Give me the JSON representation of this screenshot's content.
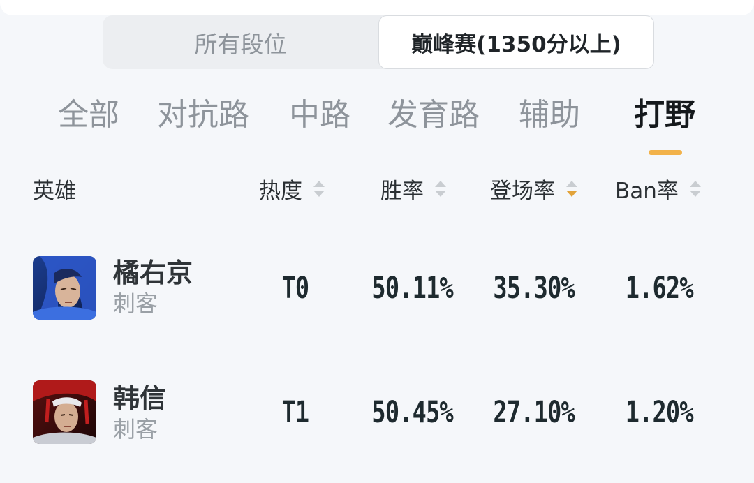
{
  "rank_filter": {
    "options": [
      "所有段位",
      "巅峰赛(1350分以上)"
    ],
    "selected": "巅峰赛(1350分以上)"
  },
  "positions": {
    "tabs": [
      "全部",
      "对抗路",
      "中路",
      "发育路",
      "辅助",
      "打野"
    ],
    "active": "打野",
    "indicator_color": "#f2b24a"
  },
  "columns": {
    "hero": "英雄",
    "heat": "热度",
    "win_rate": "胜率",
    "pick_rate": "登场率",
    "ban_rate": "Ban率",
    "active_sort": "登场率",
    "sort_direction": "descending",
    "sort_active_color": "#e2a33a"
  },
  "heroes": [
    {
      "name": "橘右京",
      "role": "刺客",
      "tier": "T0",
      "win_rate": "50.11%",
      "pick_rate": "35.30%",
      "ban_rate": "1.62%"
    },
    {
      "name": "韩信",
      "role": "刺客",
      "tier": "T1",
      "win_rate": "50.45%",
      "pick_rate": "27.10%",
      "ban_rate": "1.20%"
    }
  ]
}
